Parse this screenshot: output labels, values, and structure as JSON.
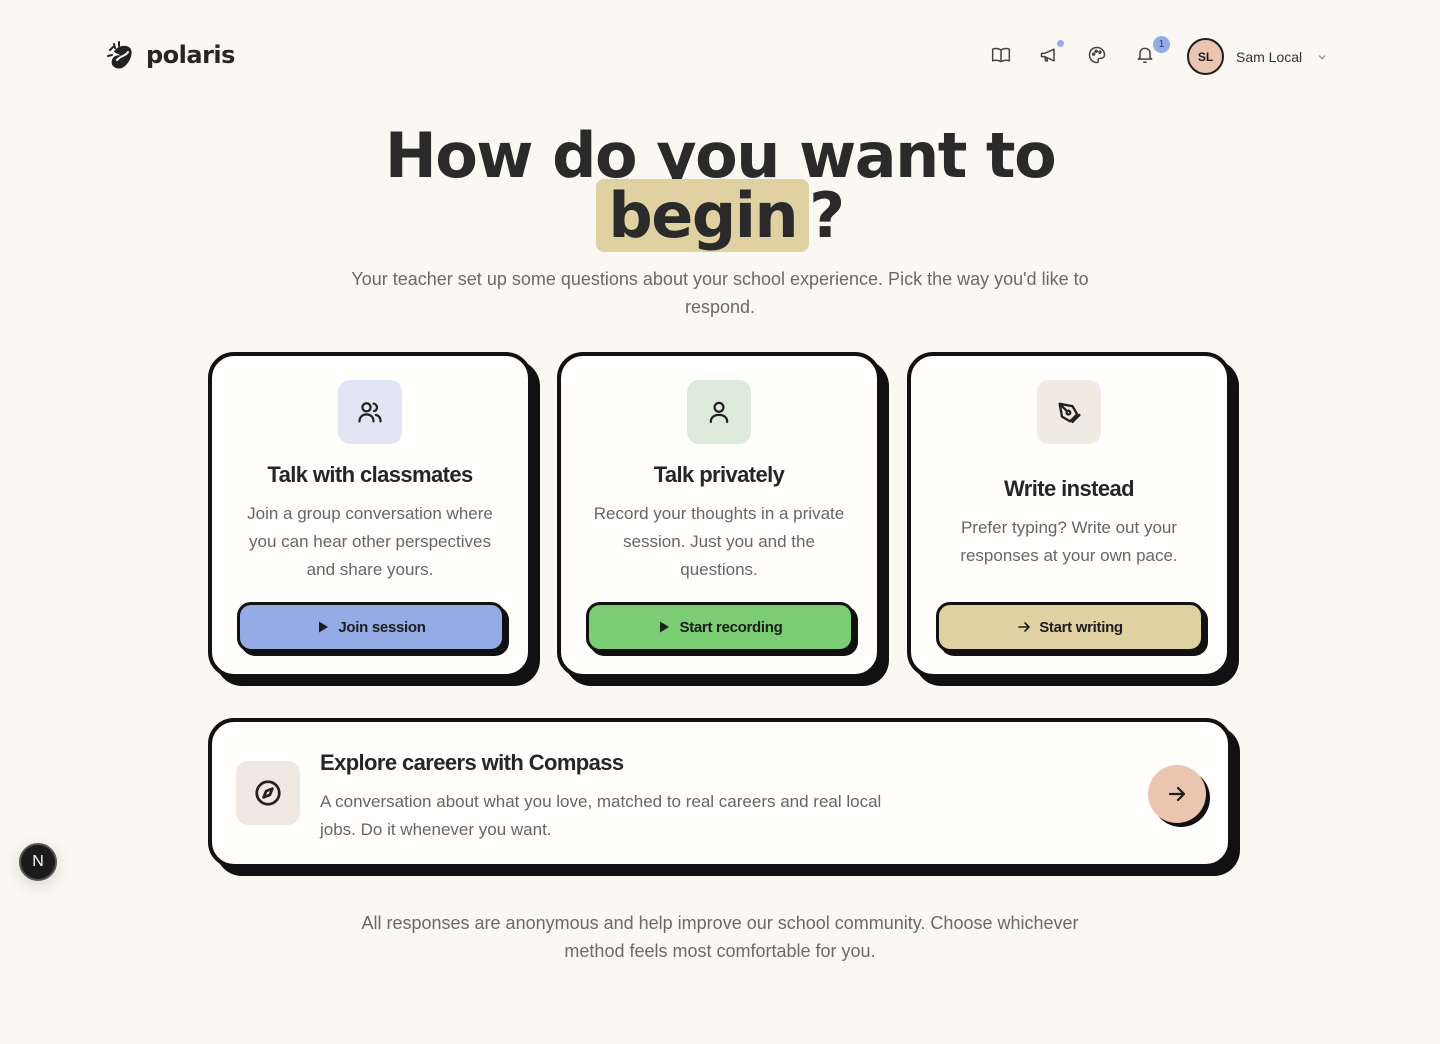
{
  "app": {
    "name": "polaris"
  },
  "header": {
    "icons": [
      "book-icon",
      "megaphone-icon",
      "palette-icon",
      "bell-icon"
    ],
    "notification_count": "1",
    "user": {
      "initials": "SL",
      "name": "Sam Local"
    }
  },
  "hero": {
    "title_line1": "How do you want to",
    "title_highlight": "begin",
    "title_suffix": "?",
    "subtitle": "Your teacher set up some questions about your school experience. Pick the way you'd like to respond."
  },
  "cards": [
    {
      "title": "Talk with classmates",
      "description": "Join a group conversation where you can hear other perspectives and share yours.",
      "button_label": "Join session",
      "accent": "#94abe6",
      "icon_bg": "#e2e6f4"
    },
    {
      "title": "Talk privately",
      "description": "Record your thoughts in a private session. Just you and the questions.",
      "button_label": "Start recording",
      "accent": "#7acd72",
      "icon_bg": "#dcebd9"
    },
    {
      "title": "Write instead",
      "description": "Prefer typing? Write out your responses at your own pace.",
      "button_label": "Start writing",
      "accent": "#dfd1a1",
      "icon_bg": "#efebe3"
    }
  ],
  "compass": {
    "title": "Explore careers with Compass",
    "description": "A conversation about what you love, matched to real careers and real local jobs. Do it whenever you want."
  },
  "footer_note": "All responses are anonymous and help improve our school community. Choose whichever method feels most comfortable for you.",
  "dev_badge": "N"
}
